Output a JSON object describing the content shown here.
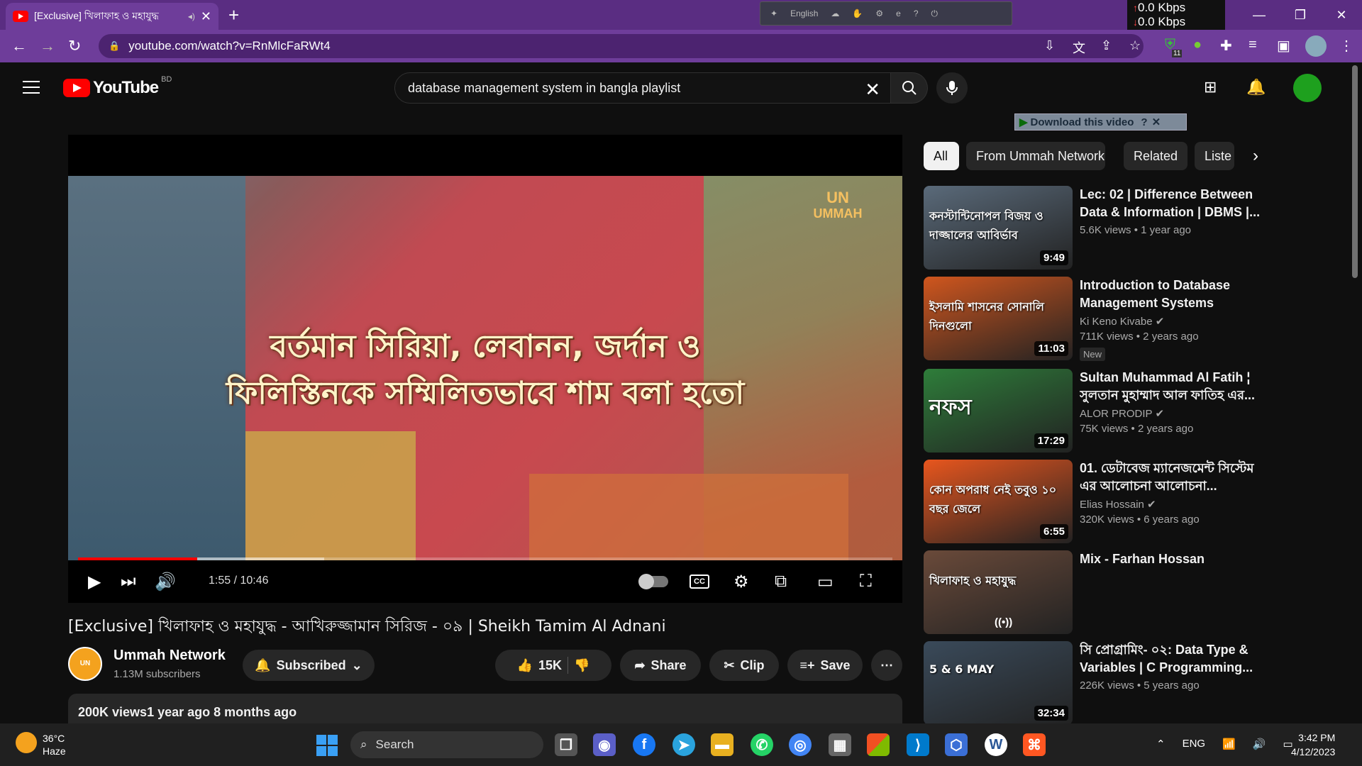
{
  "browser": {
    "tab_title": "[Exclusive] খিলাফাহ ও মহাযুদ্ধ",
    "url": "youtube.com/watch?v=RnMlcFaRWt4",
    "ext_language": "English",
    "net_down": "0.0 Kbps",
    "net_up": "0.0 Kbps",
    "ext_badge": "11"
  },
  "header": {
    "logo_text": "YouTube",
    "country_code": "BD",
    "search_value": "database management system in bangla playlist"
  },
  "download_bar": {
    "label": "Download this video"
  },
  "player": {
    "caption_line1": "বর্তমান সিরিয়া, লেবানন, জর্দান ও",
    "caption_line2": "ফিলিস্তিনকে সম্মিলিতভাবে শাম বলা হতো",
    "channel_watermark_top": "UN",
    "channel_watermark_bottom": "UMMAH",
    "time": "1:55 / 10:46",
    "progress_played": 0.146,
    "progress_buffered": 0.302
  },
  "video": {
    "title": "[Exclusive] খিলাফাহ ও মহাযুদ্ধ - আখিরুজ্জামান সিরিজ - ০৯ | Sheikh Tamim Al Adnani",
    "channel_name": "Ummah Network",
    "subscribers": "1.13M subscribers",
    "subscribed_label": "Subscribed",
    "likes": "15K",
    "share_label": "Share",
    "clip_label": "Clip",
    "save_label": "Save",
    "desc_stats": "200K views1 year ago  8 months ago"
  },
  "chips": [
    "All",
    "From Ummah Network",
    "Related",
    "Liste"
  ],
  "recommendations": [
    {
      "title": "Lec: 02 | Difference Between Data & Information | DBMS |...",
      "channel": "",
      "meta": "5.6K views  •  1 year ago",
      "duration": "9:49",
      "badge": "",
      "thumb_text": "কনস্টান্টিনোপল বিজয় ও দাজ্জালের আবির্ভাব",
      "color": "#5a6a7a"
    },
    {
      "title": "Introduction to Database Management Systems",
      "channel": "Ki Keno Kivabe",
      "meta": "711K views  •  2 years ago",
      "duration": "11:03",
      "badge": "New",
      "thumb_text": "ইসলামি শাসনের সোনালি দিনগুলো",
      "color": "#d0561e"
    },
    {
      "title": "Sultan Muhammad Al Fatih ¦ সুলতান মুহাম্মাদ আল ফাতিহ এর...",
      "channel": "ALOR PRODIP",
      "meta": "75K views  •  2 years ago",
      "duration": "17:29",
      "badge": "",
      "thumb_text": "নফস",
      "color": "#2e7d3a"
    },
    {
      "title": "01. ডেটাবেজ ম্যানেজমেন্ট সিস্টেম এর আলোচনা আলোচনা...",
      "channel": "Elias Hossain",
      "meta": "320K views  •  6 years ago",
      "duration": "6:55",
      "badge": "",
      "thumb_text": "কোন অপরাধ নেই তবুও ১০ বছর জেলে",
      "color": "#e8561e"
    },
    {
      "title": "Mix - Farhan Hossan",
      "channel": "",
      "meta": "",
      "duration": "",
      "badge": "",
      "thumb_text": "খিলাফাহ ও মহাযুদ্ধ",
      "color": "#6a4a3a"
    },
    {
      "title": "সি প্রোগ্রামিং- ০২: Data Type & Variables | C Programming...",
      "channel": "",
      "meta": "226K views  •  5 years ago",
      "duration": "32:34",
      "badge": "",
      "thumb_text": "5 & 6 MAY",
      "color": "#3a4a5a"
    }
  ],
  "taskbar": {
    "temperature": "36°C",
    "weather": "Haze",
    "search_label": "Search",
    "lang": "ENG",
    "time": "3:42 PM",
    "date": "4/12/2023"
  },
  "colors": {
    "accent": "#ff0000",
    "browser": "#6e3d9a",
    "bg": "#0f0f0f"
  }
}
